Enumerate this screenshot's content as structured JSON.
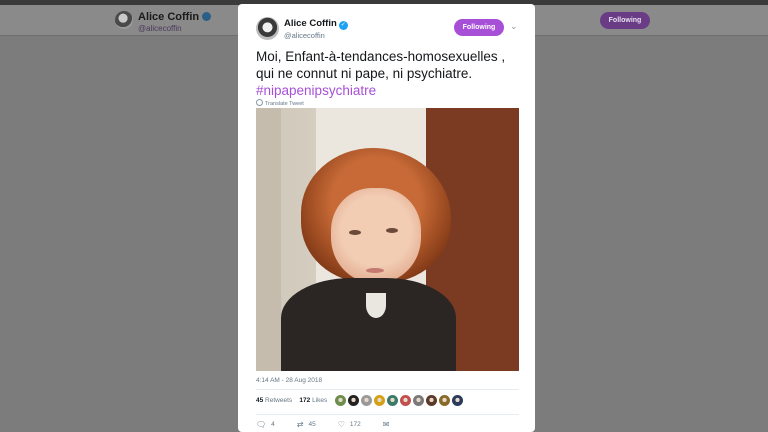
{
  "background": {
    "author_name": "Alice Coffin",
    "author_handle": "@alicecoffin",
    "follow_label": "Following"
  },
  "tweet": {
    "author_name": "Alice Coffin",
    "author_handle": "@alicecoffin",
    "follow_label": "Following",
    "text_line1": "Moi, Enfant-à-tendances-homosexuelles ,",
    "text_line2": "qui ne connut ni pape, ni psychiatre.",
    "hashtag": "#nipapenipsychiatre",
    "translate_label": "Translate Tweet",
    "timestamp": "4:14 AM - 28 Aug 2018",
    "retweets_count": "45",
    "retweets_label": "Retweets",
    "likes_count": "172",
    "likes_label": "Likes",
    "liker_colors": [
      "#6b8e4e",
      "#222222",
      "#9a9a9a",
      "#d4a017",
      "#3a7a6a",
      "#c0504d",
      "#7a7a7a",
      "#5a3a2a",
      "#8a6a2a",
      "#2a3a5a"
    ],
    "actions": {
      "reply_count": "4",
      "retweet_count": "45",
      "like_count": "172"
    },
    "accent_color": "#a74fd6"
  }
}
